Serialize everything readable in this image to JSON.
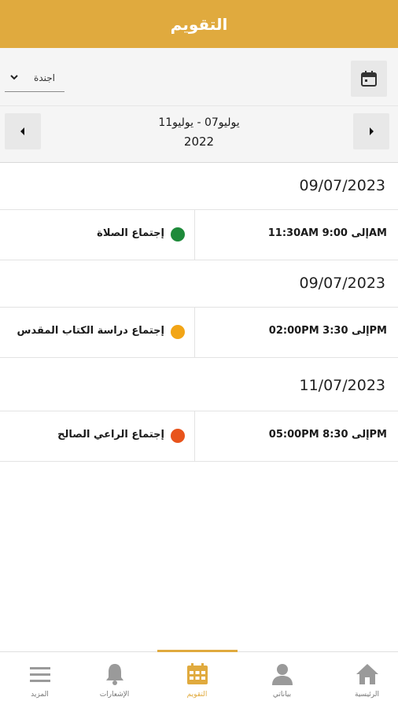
{
  "appbar": {
    "title": "التقويم"
  },
  "toolbar": {
    "view_select_value": "اجندة",
    "calendar_button_icon": "calendar-icon"
  },
  "range": {
    "line1": "يوليو07  -  يوليو11",
    "line2": "2022",
    "prev_icon": "caret-left-icon",
    "next_icon": "caret-right-icon"
  },
  "agenda": [
    {
      "date": "09/07/2023",
      "time": "11:30AM إلى 9:00AM",
      "title": "إجتماع الصلاة",
      "dot_color": "#1e8a3a"
    },
    {
      "date": "09/07/2023",
      "time": "02:00PM إلى 3:30PM",
      "title": "إجتماع دراسة الكتاب المقدس",
      "dot_color": "#f2a516"
    },
    {
      "date": "11/07/2023",
      "time": "05:00PM إلى 8:30PM",
      "title": "إجتماع الراعي الصالح",
      "dot_color": "#e8541c"
    }
  ],
  "tabbar": {
    "tabs": [
      {
        "label": "المزيد",
        "icon": "menu-icon",
        "active": false
      },
      {
        "label": "الإشعارات",
        "icon": "bell-icon",
        "active": false
      },
      {
        "label": "التقويم",
        "icon": "calendar-icon",
        "active": true
      },
      {
        "label": "بياناتي",
        "icon": "user-icon",
        "active": false
      },
      {
        "label": "الرئيسية",
        "icon": "home-icon",
        "active": false
      }
    ]
  },
  "colors": {
    "accent": "#e0aa3e",
    "inactive_icon": "#9a9a9a"
  }
}
